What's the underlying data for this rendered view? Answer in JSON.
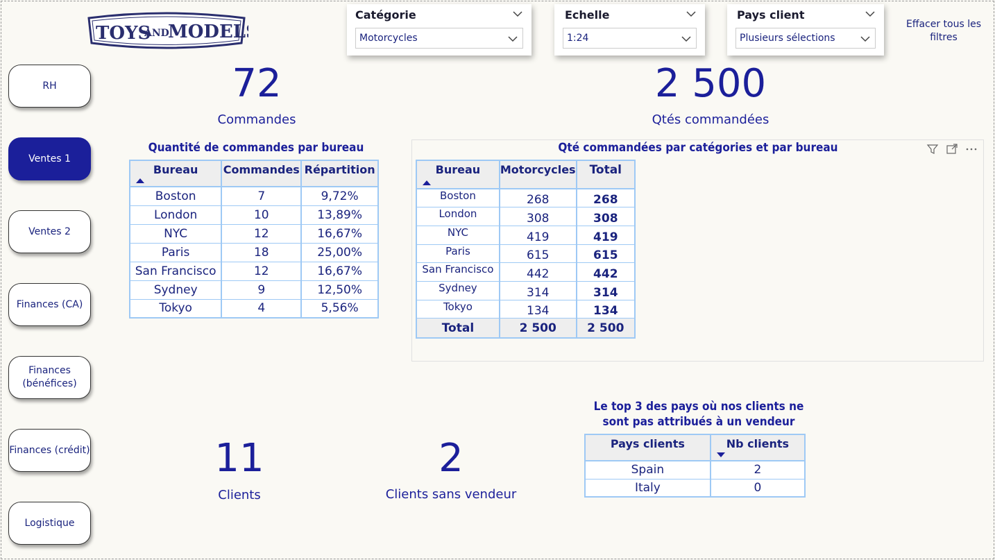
{
  "logo": {
    "text_main": "TOYS",
    "text_and": "AND",
    "text_models": "MODELS"
  },
  "nav": [
    {
      "label": "RH",
      "active": false
    },
    {
      "label": "Ventes 1",
      "active": true
    },
    {
      "label": "Ventes 2",
      "active": false
    },
    {
      "label": "Finances (CA)",
      "active": false
    },
    {
      "label": "Finances (bénéfices)",
      "active": false
    },
    {
      "label": "Finances (crédit)",
      "active": false
    },
    {
      "label": "Logistique",
      "active": false
    }
  ],
  "slicers": {
    "categorie": {
      "title": "Catégorie",
      "value": "Motorcycles"
    },
    "echelle": {
      "title": "Echelle",
      "value": "1:24"
    },
    "pays": {
      "title": "Pays client",
      "value": "Plusieurs sélections"
    }
  },
  "clear_filters": "Effacer tous les filtres",
  "kpis": {
    "commandes": {
      "value": "72",
      "label": "Commandes"
    },
    "qtes": {
      "value": "2 500",
      "label": "Qtés commandées"
    },
    "clients": {
      "value": "11",
      "label": "Clients"
    },
    "sans_vendeur": {
      "value": "2",
      "label": "Clients sans vendeur"
    }
  },
  "table_bureau": {
    "title": "Quantité de commandes par bureau",
    "headers": [
      "Bureau",
      "Commandes",
      "Répartition"
    ],
    "rows": [
      [
        "Boston",
        "7",
        "9,72%"
      ],
      [
        "London",
        "10",
        "13,89%"
      ],
      [
        "NYC",
        "12",
        "16,67%"
      ],
      [
        "Paris",
        "18",
        "25,00%"
      ],
      [
        "San Francisco",
        "12",
        "16,67%"
      ],
      [
        "Sydney",
        "9",
        "12,50%"
      ],
      [
        "Tokyo",
        "4",
        "5,56%"
      ]
    ]
  },
  "matrix": {
    "title": "Qté commandées par catégories et par bureau",
    "headers": [
      "Bureau",
      "Motorcycles",
      "Total"
    ],
    "rows": [
      [
        "Boston",
        "268",
        "268"
      ],
      [
        "London",
        "308",
        "308"
      ],
      [
        "NYC",
        "419",
        "419"
      ],
      [
        "Paris",
        "615",
        "615"
      ],
      [
        "San Francisco",
        "442",
        "442"
      ],
      [
        "Sydney",
        "314",
        "314"
      ],
      [
        "Tokyo",
        "134",
        "134"
      ]
    ],
    "total": [
      "Total",
      "2 500",
      "2 500"
    ]
  },
  "top3": {
    "title_line1": "Le top 3 des pays où nos clients ne",
    "title_line2": "sont pas attribués à un vendeur",
    "headers": [
      "Pays clients",
      "Nb clients"
    ],
    "rows": [
      [
        "Spain",
        "2"
      ],
      [
        "Italy",
        "0"
      ]
    ]
  },
  "colors": {
    "accent": "#1b1f9a",
    "background": "#faf9f4",
    "grid": "#9ec9f5"
  }
}
